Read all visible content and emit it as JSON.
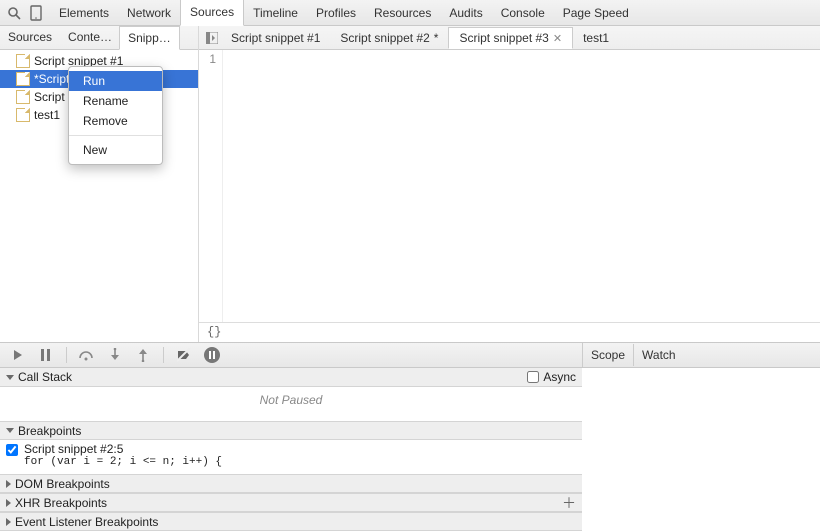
{
  "top_tabs": [
    "Elements",
    "Network",
    "Sources",
    "Timeline",
    "Profiles",
    "Resources",
    "Audits",
    "Console",
    "Page Speed"
  ],
  "top_selected": "Sources",
  "left_tabs": [
    "Sources",
    "Conte…",
    "Snipp…"
  ],
  "left_selected": "Snipp…",
  "tree_items": [
    "Script snippet #1",
    "*Script snippet #2",
    "Script snippet #3",
    "test1"
  ],
  "tree_selected": 1,
  "context_menu": {
    "items": [
      "Run",
      "Rename",
      "Remove",
      "New"
    ],
    "highlight": "Run"
  },
  "file_tabs": [
    {
      "label": "Script snippet #1",
      "modified": false,
      "active": false
    },
    {
      "label": "Script snippet #2",
      "modified": true,
      "active": false
    },
    {
      "label": "Script snippet #3",
      "modified": false,
      "active": true
    },
    {
      "label": "test1",
      "modified": false,
      "active": false
    }
  ],
  "gutter_line": "1",
  "braces": "{}",
  "right_tabs": [
    "Scope",
    "Watch"
  ],
  "panels": {
    "call_stack": {
      "title": "Call Stack",
      "async_label": "Async",
      "body": "Not Paused"
    },
    "breakpoints": {
      "title": "Breakpoints",
      "item_label": "Script snippet #2:5",
      "item_code": "for (var i = 2; i <= n; i++) {"
    },
    "dom": "DOM Breakpoints",
    "xhr": "XHR Breakpoints",
    "evt": "Event Listener Breakpoints"
  }
}
